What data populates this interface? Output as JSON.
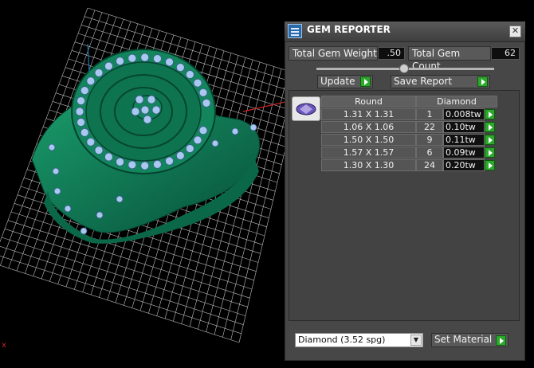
{
  "window": {
    "title": "GEM REPORTER",
    "close_glyph": "✕"
  },
  "stats": {
    "weight_label": "Total Gem Weight",
    "weight_value": ".50",
    "count_label": "Total Gem Count",
    "count_value": "62"
  },
  "buttons": {
    "update": "Update",
    "save_report": "Save Report",
    "set_material": "Set Material"
  },
  "table": {
    "headers": {
      "shape": "Round",
      "material": "Diamond"
    },
    "rows": [
      {
        "size": "1.31 X 1.31",
        "count": "1",
        "weight": "0.008tw"
      },
      {
        "size": "1.06 X 1.06",
        "count": "22",
        "weight": "0.10tw"
      },
      {
        "size": "1.50 X 1.50",
        "count": "9",
        "weight": "0.11tw"
      },
      {
        "size": "1.57 X 1.57",
        "count": "6",
        "weight": "0.09tw"
      },
      {
        "size": "1.30 X 1.30",
        "count": "24",
        "weight": "0.20tw"
      }
    ]
  },
  "material_select": {
    "value": "Diamond     (3.52 spg)"
  },
  "viewport": {
    "axis_label": "x"
  },
  "colors": {
    "ring": "#0f7a55",
    "gems": "#a9c8f0",
    "grid": "#cfcfcf",
    "accent": "#2ca82c"
  }
}
